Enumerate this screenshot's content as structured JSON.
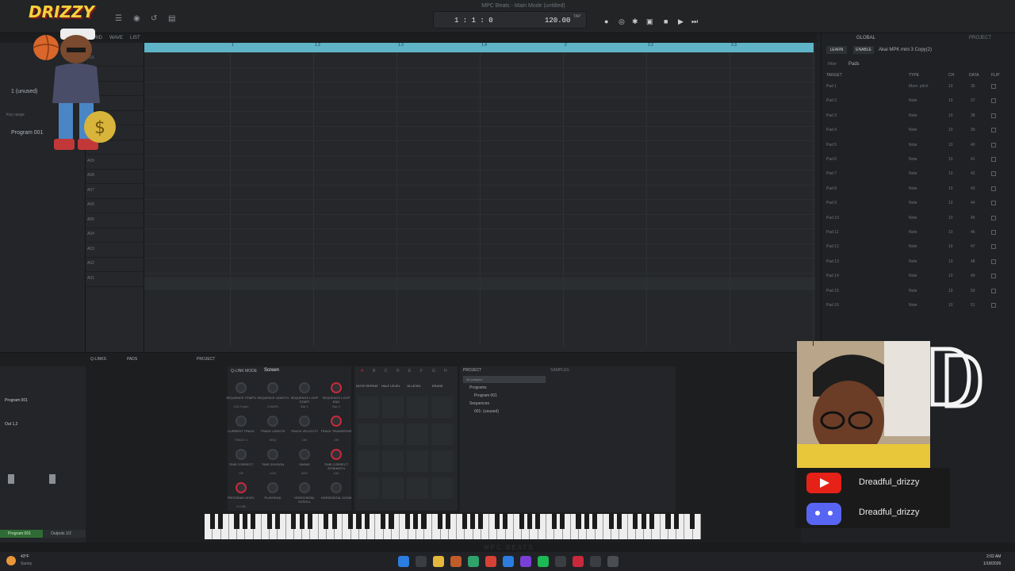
{
  "window": {
    "title": "MPC Beats - Main Mode (untitled)"
  },
  "transport": {
    "bar_display": "1 : 1 : 0",
    "tempo": "120.00",
    "tap_label": "TAP"
  },
  "views": {
    "tabs": [
      "GRID",
      "WAVE",
      "LIST"
    ]
  },
  "left_panel": {
    "track_name": "1 (unused)",
    "key_range_label": "Key range",
    "program_name": "Program 001"
  },
  "ruler": {
    "ticks": [
      "1",
      "1.2",
      "1.3",
      "1.4",
      "2",
      "2.2",
      "2.3",
      "2.4"
    ]
  },
  "pads_rows": [
    "A16",
    "A15",
    "A14",
    "A13",
    "A12",
    "A11",
    "A10",
    "A09",
    "A08",
    "A07",
    "A06",
    "A05",
    "A04",
    "A03",
    "A02",
    "A01"
  ],
  "right_panel": {
    "tabs": {
      "global": "GLOBAL",
      "project": "PROJECT"
    },
    "learn": "LEARN",
    "enable": "ENABLE",
    "device": "Akai MPK mini 3 Copy(2)",
    "filter_label": "Filter",
    "filter_value": "Pads",
    "columns": [
      "TARGET",
      "TYPE",
      "CH",
      "DATA",
      "FLIP"
    ],
    "rows": [
      {
        "target": "Pad 1",
        "type": "Mom. pitch",
        "ch": "10",
        "data": "36"
      },
      {
        "target": "Pad 2",
        "type": "Note",
        "ch": "10",
        "data": "37"
      },
      {
        "target": "Pad 3",
        "type": "Note",
        "ch": "10",
        "data": "38"
      },
      {
        "target": "Pad 4",
        "type": "Note",
        "ch": "10",
        "data": "39"
      },
      {
        "target": "Pad 5",
        "type": "Note",
        "ch": "10",
        "data": "40"
      },
      {
        "target": "Pad 6",
        "type": "Note",
        "ch": "10",
        "data": "41"
      },
      {
        "target": "Pad 7",
        "type": "Note",
        "ch": "10",
        "data": "42"
      },
      {
        "target": "Pad 8",
        "type": "Note",
        "ch": "10",
        "data": "43"
      },
      {
        "target": "Pad 9",
        "type": "Note",
        "ch": "10",
        "data": "44"
      },
      {
        "target": "Pad 10",
        "type": "Note",
        "ch": "10",
        "data": "45"
      },
      {
        "target": "Pad 11",
        "type": "Note",
        "ch": "10",
        "data": "46"
      },
      {
        "target": "Pad 12",
        "type": "Note",
        "ch": "10",
        "data": "47"
      },
      {
        "target": "Pad 13",
        "type": "Note",
        "ch": "10",
        "data": "48"
      },
      {
        "target": "Pad 14",
        "type": "Note",
        "ch": "10",
        "data": "49"
      },
      {
        "target": "Pad 15",
        "type": "Note",
        "ch": "10",
        "data": "50"
      },
      {
        "target": "Pad 16",
        "type": "Note",
        "ch": "10",
        "data": "51"
      }
    ]
  },
  "bottom_tabs": [
    "Q-LINKS",
    "PADS",
    "PROJECT"
  ],
  "qlink": {
    "mode_label": "Q-LINK MODE",
    "mode_value": "Screen",
    "knobs": [
      {
        "label": "SEQUENCE TEMPO",
        "value": "120.0 bpm"
      },
      {
        "label": "SEQUENCE LENGTH",
        "value": "2 BARS"
      },
      {
        "label": "SEQUENCE LOOP START",
        "value": "Bar 1"
      },
      {
        "label": "SEQUENCE LOOP END",
        "value": "Bar 2"
      },
      {
        "label": "CURRENT TRACK",
        "value": "TRACK 1"
      },
      {
        "label": "TRACK LENGTH",
        "value": "SEQ"
      },
      {
        "label": "TRACK VELOCITY",
        "value": "100"
      },
      {
        "label": "TRACK TRANSPOSE",
        "value": "Off"
      },
      {
        "label": "TIME CORRECT",
        "value": "Off"
      },
      {
        "label": "TIME DIVISION",
        "value": "1/16"
      },
      {
        "label": "SWING",
        "value": "50%"
      },
      {
        "label": "TIME CORRECT STRENGTH",
        "value": "100"
      },
      {
        "label": "PROGRAM LEVEL",
        "value": "0.0 dB"
      },
      {
        "label": "PLAYHEAD",
        "value": ""
      },
      {
        "label": "HORIZONTAL SCROLL",
        "value": ""
      },
      {
        "label": "HORIZONTAL ZOOM",
        "value": ""
      }
    ]
  },
  "pads": {
    "bank_letters": [
      "A",
      "B",
      "C",
      "D",
      "E",
      "F",
      "G",
      "H"
    ],
    "buttons": [
      "NOTE REPEAT",
      "HALF LEVEL",
      "16 LEVEL",
      "ERASE"
    ]
  },
  "project_panel": {
    "tabs": [
      "PROJECT",
      "SAMPLES"
    ],
    "search": "All samples",
    "tree": [
      "Programs",
      "Program 001",
      "Sequences",
      "001: (unused)"
    ]
  },
  "mixer": {
    "program_name": "Program 001",
    "output": "Out 1,2",
    "bottom_left": "Program 001",
    "bottom_right": "Outputs 1/2"
  },
  "status_bar": {
    "watermark": "MPC BEATS"
  },
  "taskbar": {
    "weather_temp": "43°F",
    "weather_desc": "Sunny",
    "time": "2:02 AM",
    "date": "1/18/2026"
  },
  "overlays": {
    "logo_text": "DRIZZY",
    "social": [
      {
        "platform": "youtube-icon",
        "name": "Dreadful_drizzy"
      },
      {
        "platform": "discord-icon",
        "name": "Dreadful_drizzy"
      }
    ]
  },
  "colors": {
    "accent": "#5fb4c8",
    "record": "#c8293b",
    "youtube": "#e62117",
    "discord": "#5865f2",
    "active_green": "#2f6b34"
  }
}
